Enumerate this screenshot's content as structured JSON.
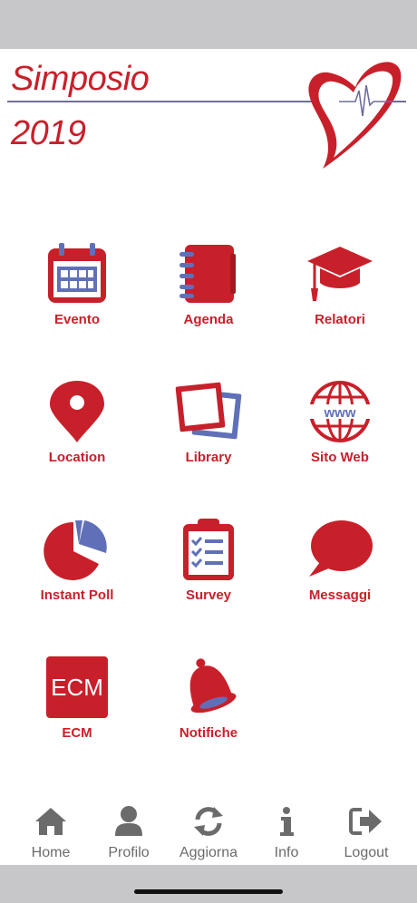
{
  "header": {
    "title_line1": "Simposio",
    "title_line2": "2019"
  },
  "colors": {
    "primary": "#c8202a",
    "accent": "#6070b8",
    "tab_gray": "#6b6b6b"
  },
  "grid": {
    "items": [
      {
        "label": "Evento",
        "icon": "calendar-icon"
      },
      {
        "label": "Agenda",
        "icon": "notebook-icon"
      },
      {
        "label": "Relatori",
        "icon": "graduation-cap-icon"
      },
      {
        "label": "Location",
        "icon": "map-pin-icon"
      },
      {
        "label": "Library",
        "icon": "photos-icon"
      },
      {
        "label": "Sito Web",
        "icon": "globe-www-icon"
      },
      {
        "label": "Instant Poll",
        "icon": "pie-chart-icon"
      },
      {
        "label": "Survey",
        "icon": "checklist-clipboard-icon"
      },
      {
        "label": "Messaggi",
        "icon": "speech-bubble-icon"
      },
      {
        "label": "ECM",
        "icon": "ecm-icon",
        "icon_text": "ECM"
      },
      {
        "label": "Notifiche",
        "icon": "bell-icon"
      }
    ]
  },
  "tabbar": {
    "items": [
      {
        "label": "Home",
        "icon": "home-icon"
      },
      {
        "label": "Profilo",
        "icon": "user-icon"
      },
      {
        "label": "Aggiorna",
        "icon": "refresh-icon"
      },
      {
        "label": "Info",
        "icon": "info-icon"
      },
      {
        "label": "Logout",
        "icon": "logout-icon"
      }
    ]
  }
}
